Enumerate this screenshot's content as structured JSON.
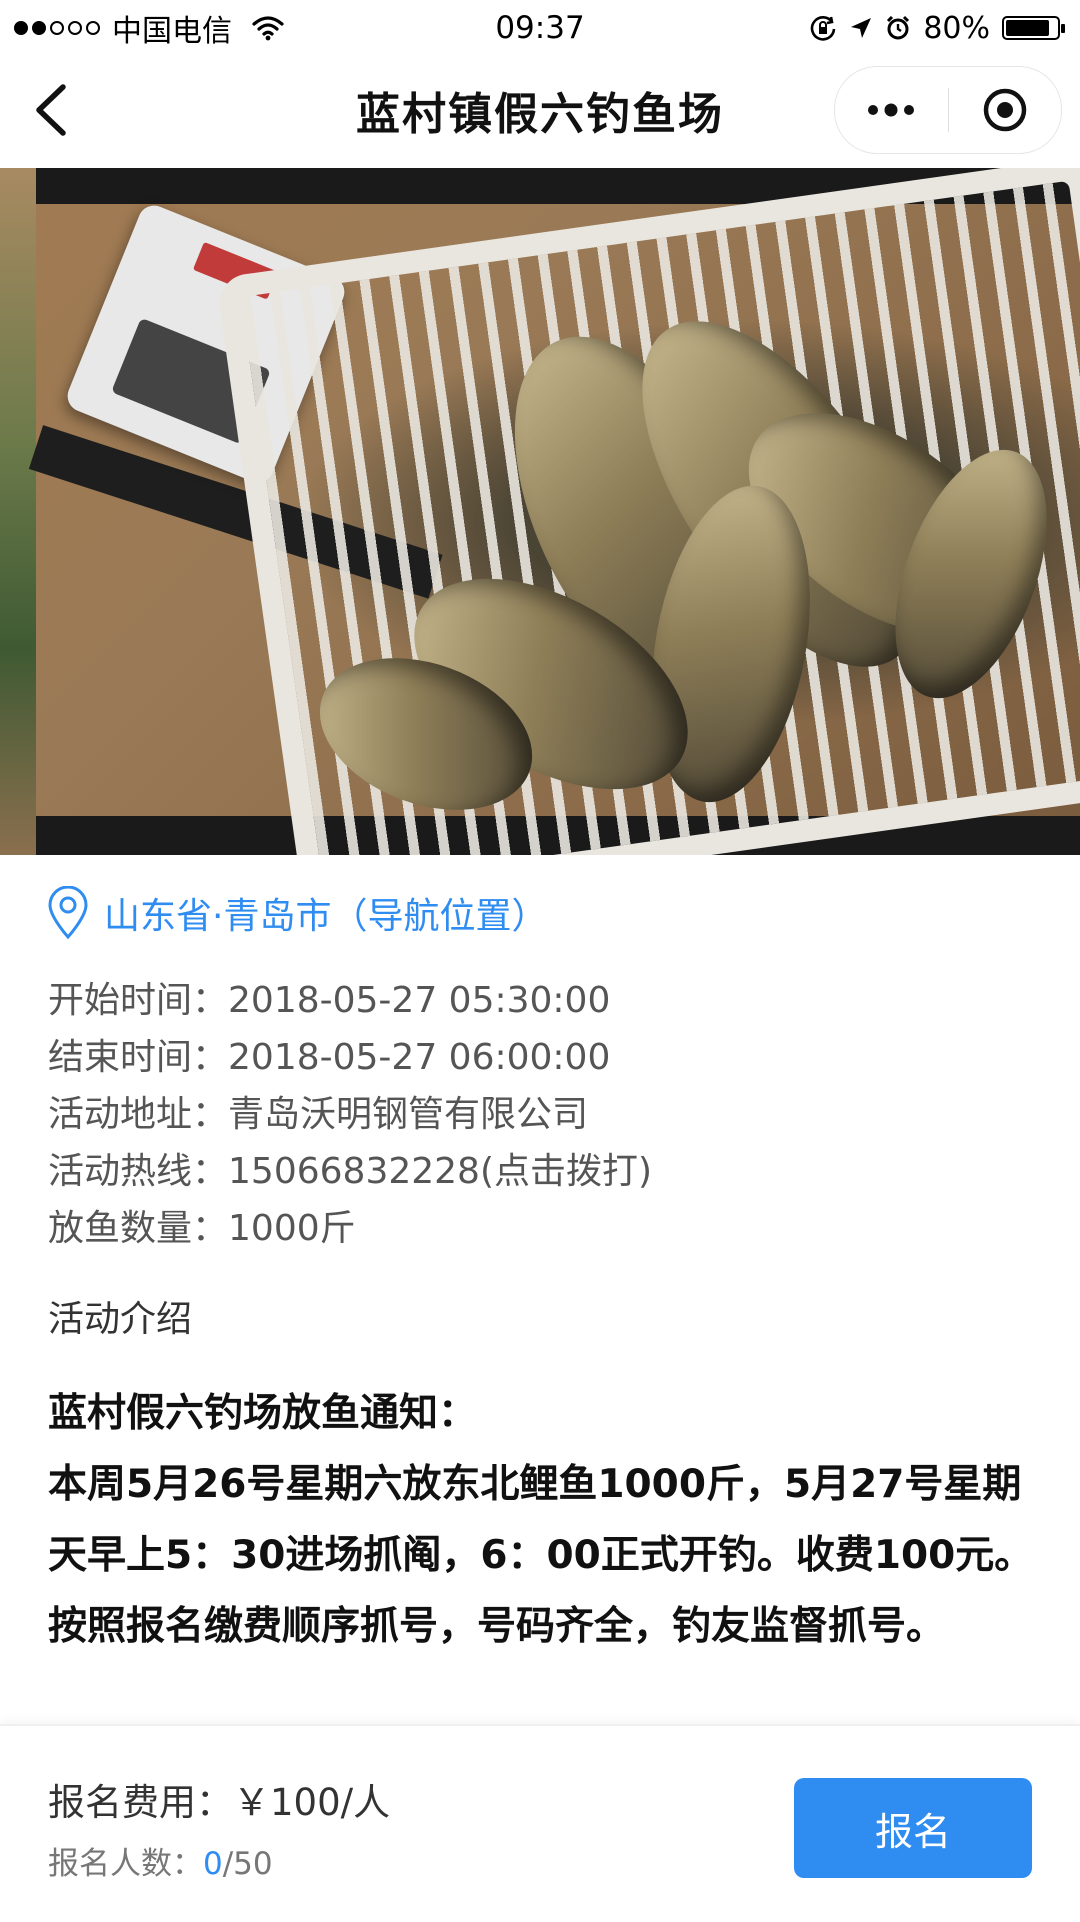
{
  "status_bar": {
    "carrier": "中国电信",
    "time": "09:37",
    "battery": "80%",
    "icons": [
      "signal-dots-icon",
      "wifi-icon",
      "rotation-lock-icon",
      "location-arrow-icon",
      "alarm-icon",
      "battery-icon"
    ]
  },
  "nav": {
    "title": "蓝村镇假六钓鱼场",
    "back_icon": "chevron-left-icon",
    "more_icon": "more-dots-icon",
    "close_icon": "target-circle-icon"
  },
  "carousel": {
    "page_count": 6,
    "active_index": 4
  },
  "location": {
    "icon": "map-pin-icon",
    "text": "山东省·青岛市（导航位置）"
  },
  "info": {
    "start": {
      "label": "开始时间：",
      "value": "2018-05-27 05:30:00"
    },
    "end": {
      "label": "结束时间：",
      "value": "2018-05-27 06:00:00"
    },
    "address": {
      "label": "活动地址：",
      "value": "青岛沃明钢管有限公司"
    },
    "hotline": {
      "label": "活动热线：",
      "value": "15066832228(点击拨打)"
    },
    "fish_amount": {
      "label": "放鱼数量：",
      "value": "1000斤"
    }
  },
  "intro": {
    "label": "活动介绍",
    "heading": "蓝村假六钓场放鱼通知：",
    "body": "本周5月26号星期六放东北鲤鱼1000斤，5月27号星期天早上5：30进场抓阄，6：00正式开钓。收费100元。按照报名缴费顺序抓号，号码齐全，钓友监督抓号。"
  },
  "footer": {
    "fee_label": "报名费用：",
    "fee_value": "￥100/人",
    "count_label": "报名人数：",
    "count_current": "0",
    "count_total": "/50",
    "button_label": "报名"
  },
  "colors": {
    "accent": "#2f8cf0",
    "text": "#222222",
    "muted": "#555555"
  }
}
